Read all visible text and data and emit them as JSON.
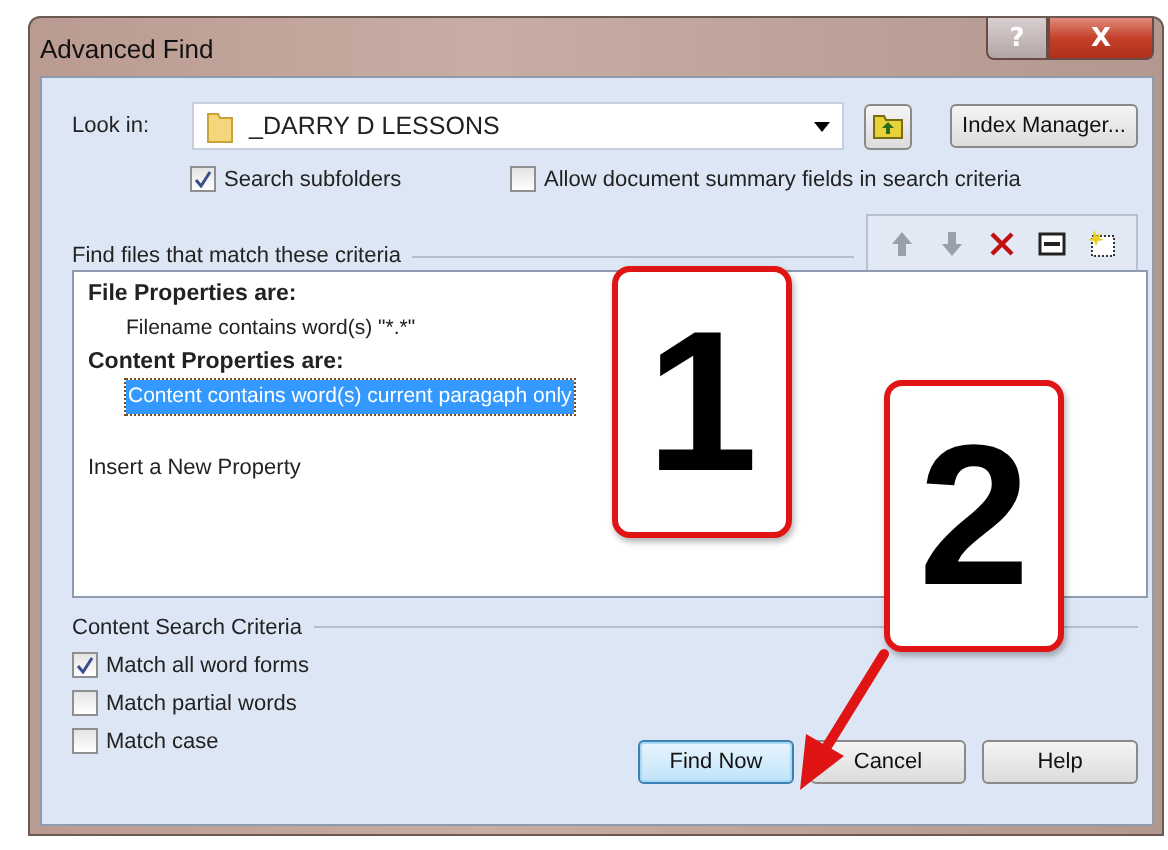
{
  "window": {
    "title": "Advanced Find",
    "help_button": "?",
    "close_button": "X"
  },
  "look_in": {
    "label": "Look in:",
    "value": "_DARRY D LESSONS",
    "index_button": "Index Manager..."
  },
  "options": [
    {
      "label": "Search subfolders",
      "checked": true
    },
    {
      "label": "Allow document summary fields in search criteria",
      "checked": false
    }
  ],
  "criteria": {
    "title": "Find files that match these criteria",
    "items": [
      {
        "kind": "heading",
        "text": "File Properties are:",
        "selected": false
      },
      {
        "kind": "property",
        "text": "Filename contains word(s) \"*.*\"",
        "selected": false
      },
      {
        "kind": "heading",
        "text": "Content Properties are:",
        "selected": false
      },
      {
        "kind": "property",
        "text": "Content contains word(s) current paragaph only",
        "selected": true
      },
      {
        "kind": "action",
        "text": "Insert a New Property",
        "selected": false
      }
    ]
  },
  "content_search": {
    "title": "Content Search Criteria",
    "options": [
      {
        "label": "Match all word forms",
        "checked": true
      },
      {
        "label": "Match partial words",
        "checked": false
      },
      {
        "label": "Match case",
        "checked": false
      }
    ]
  },
  "buttons": [
    {
      "label": "Find Now",
      "default": true
    },
    {
      "label": "Cancel",
      "default": false
    },
    {
      "label": "Help",
      "default": false
    }
  ],
  "callouts": [
    "1",
    "2"
  ]
}
